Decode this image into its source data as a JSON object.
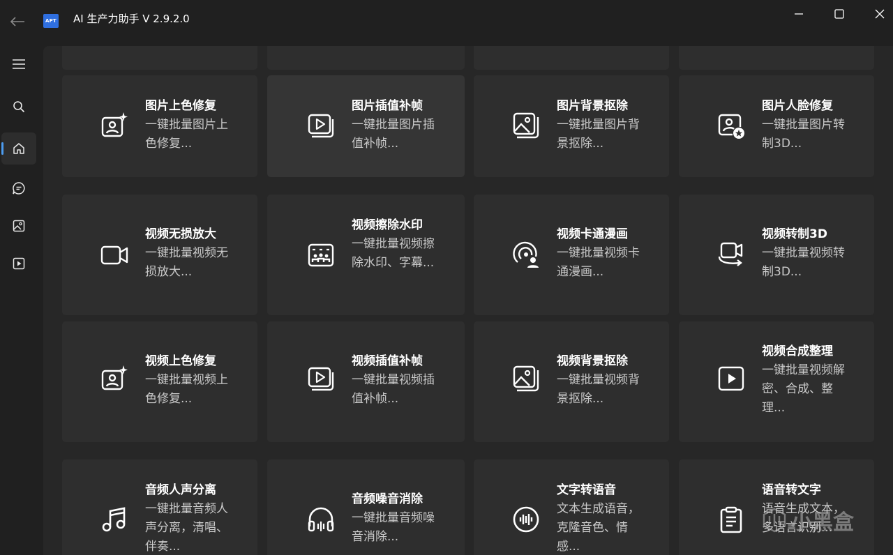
{
  "window": {
    "logo_text": "APT",
    "title": "AI 生产力助手 V 2.9.2.0"
  },
  "sidebar": {
    "items": [
      {
        "icon": "menu-icon"
      },
      {
        "icon": "search-icon"
      },
      {
        "icon": "home-icon",
        "active": true
      },
      {
        "icon": "chat-icon"
      },
      {
        "icon": "image-icon"
      },
      {
        "icon": "video-icon"
      }
    ]
  },
  "cards": [
    {
      "title": "图片上色修复",
      "desc": "一键批量图片上色修复...",
      "icon": "portrait-sparkle-icon"
    },
    {
      "title": "图片插值补帧",
      "desc": "一键批量图片插值补帧...",
      "icon": "play-stack-icon"
    },
    {
      "title": "图片背景抠除",
      "desc": "一键批量图片背景抠除...",
      "icon": "image-stack-icon"
    },
    {
      "title": "图片人脸修复",
      "desc": "一键批量图片转制3D...",
      "icon": "portrait-star-icon"
    },
    {
      "title": "视频无损放大",
      "desc": "一键批量视频无损放大...",
      "icon": "video-camera-icon"
    },
    {
      "title": "视频擦除水印",
      "desc": "一键批量视频擦除水印、字幕...",
      "icon": "people-frame-icon"
    },
    {
      "title": "视频卡通漫画",
      "desc": "一键批量视频卡通漫画...",
      "icon": "broadcast-person-icon"
    },
    {
      "title": "视频转制3D",
      "desc": "一键批量视频转制3D...",
      "icon": "video-rotate-icon"
    },
    {
      "title": "视频上色修复",
      "desc": "一键批量视频上色修复...",
      "icon": "portrait-sparkle-icon"
    },
    {
      "title": "视频插值补帧",
      "desc": "一键批量视频插值补帧...",
      "icon": "play-stack-icon"
    },
    {
      "title": "视频背景抠除",
      "desc": "一键批量视频背景抠除...",
      "icon": "image-stack-icon"
    },
    {
      "title": "视频合成整理",
      "desc": "一键批量视频解密、合成、整理...",
      "icon": "play-box-icon"
    },
    {
      "title": "音频人声分离",
      "desc": "一键批量音频人声分离，清唱、伴奏...",
      "icon": "music-note-icon"
    },
    {
      "title": "音频噪音消除",
      "desc": "一键批量音频噪音消除...",
      "icon": "headphones-icon"
    },
    {
      "title": "文字转语音",
      "desc": "文本生成语音，克隆音色、情感...",
      "icon": "voice-wave-icon"
    },
    {
      "title": "语音转文字",
      "desc": "语音生成文本，多语言识别...",
      "icon": "clipboard-icon"
    }
  ],
  "watermark": {
    "text": "小黑盒"
  },
  "colors": {
    "background": "#202020",
    "card": "#2e2e2e",
    "accent": "#4d9cf0"
  }
}
